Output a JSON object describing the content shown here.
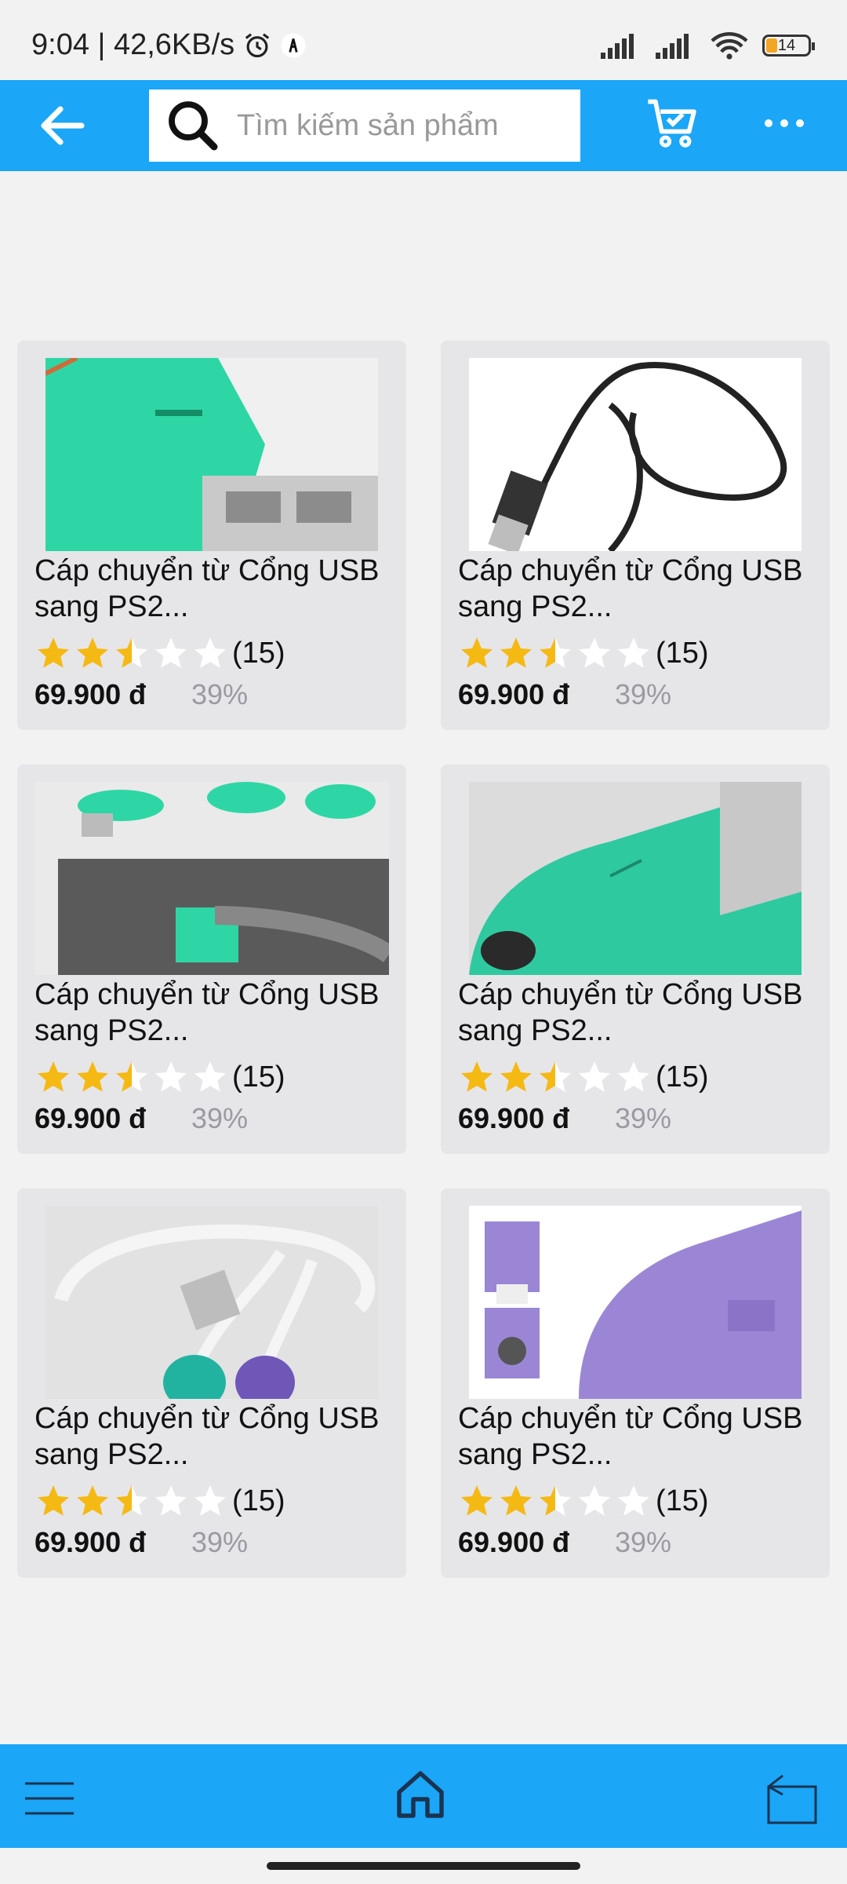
{
  "status_bar": {
    "time_speed": "9:04 | 42,6KB/s",
    "battery": "14"
  },
  "top_bar": {
    "search_placeholder": "Tìm kiếm sản phẩm",
    "accent_color": "#1ba6f7"
  },
  "products": [
    {
      "title": "Cáp chuyển từ Cổng USB sang PS2...",
      "rating": 2.5,
      "review_count": "(15)",
      "price": "69.900 đ",
      "discount": "39%",
      "image": "green-usb-ps2-adapter"
    },
    {
      "title": "Cáp chuyển từ Cổng USB sang PS2...",
      "rating": 2.5,
      "review_count": "(15)",
      "price": "69.900 đ",
      "discount": "39%",
      "image": "black-usb-cable"
    },
    {
      "title": "Cáp chuyển từ Cổng USB sang PS2...",
      "rating": 2.5,
      "review_count": "(15)",
      "price": "69.900 đ",
      "discount": "39%",
      "image": "adapters-on-pc"
    },
    {
      "title": "Cáp chuyển từ Cổng USB sang PS2...",
      "rating": 2.5,
      "review_count": "(15)",
      "price": "69.900 đ",
      "discount": "39%",
      "image": "green-adapter-closeup"
    },
    {
      "title": "Cáp chuyển từ Cổng USB sang PS2...",
      "rating": 2.5,
      "review_count": "(15)",
      "price": "69.900 đ",
      "discount": "39%",
      "image": "y-splitter-cable"
    },
    {
      "title": "Cáp chuyển từ Cổng USB sang PS2...",
      "rating": 2.5,
      "review_count": "(15)",
      "price": "69.900 đ",
      "discount": "39%",
      "image": "purple-adapter"
    }
  ],
  "icons": {
    "back": "back-arrow-icon",
    "search": "search-icon",
    "cart": "cart-icon",
    "more": "more-icon",
    "menu": "menu-icon",
    "home": "home-icon",
    "switch": "switch-icon"
  }
}
